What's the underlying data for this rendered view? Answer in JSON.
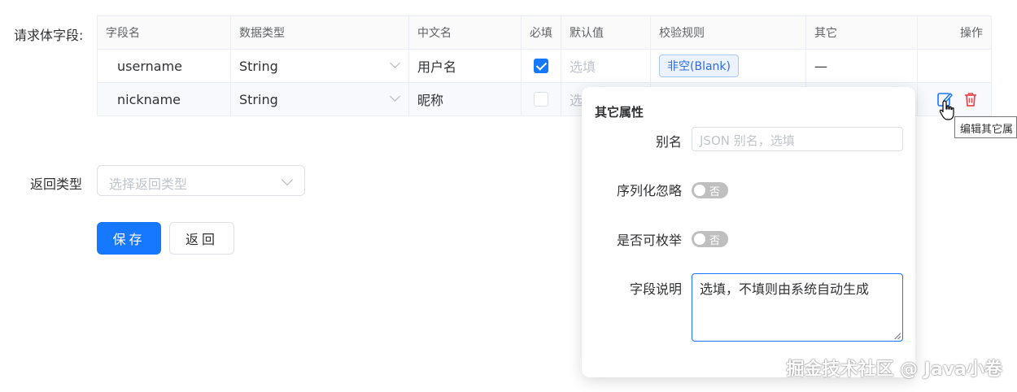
{
  "form": {
    "request_body_label": "请求体字段:",
    "return_type_label": "返回类型",
    "return_type_placeholder": "选择返回类型",
    "save_label": "保存",
    "back_label": "返回"
  },
  "table": {
    "headers": [
      "字段名",
      "数据类型",
      "中文名",
      "必填",
      "默认值",
      "校验规则",
      "其它",
      "操作"
    ],
    "rows": [
      {
        "field_name": "username",
        "data_type": "String",
        "cn_name": "用户名",
        "required": true,
        "default_placeholder": "选填",
        "rule_tag": "非空(Blank)",
        "other": "—"
      },
      {
        "field_name": "nickname",
        "data_type": "String",
        "cn_name": "昵称",
        "required": false,
        "default_placeholder": "选"
      }
    ]
  },
  "popover": {
    "title": "其它属性",
    "alias_label": "别名",
    "alias_placeholder": "JSON 别名，选填",
    "serialize_ignore_label": "序列化忽略",
    "serialize_ignore_state": "否",
    "enumerable_label": "是否可枚举",
    "enumerable_state": "否",
    "desc_label": "字段说明",
    "desc_value": "选填，不填则由系统自动生成"
  },
  "tooltip": {
    "text": "编辑其它属"
  },
  "watermark": {
    "text": "掘金技术社区 @ Java小卷"
  },
  "colors": {
    "primary": "#1677ff",
    "danger": "#e5484d",
    "tag_bg": "#ecf3fe"
  },
  "icons": {
    "edit": "edit-icon",
    "delete": "trash-icon"
  }
}
